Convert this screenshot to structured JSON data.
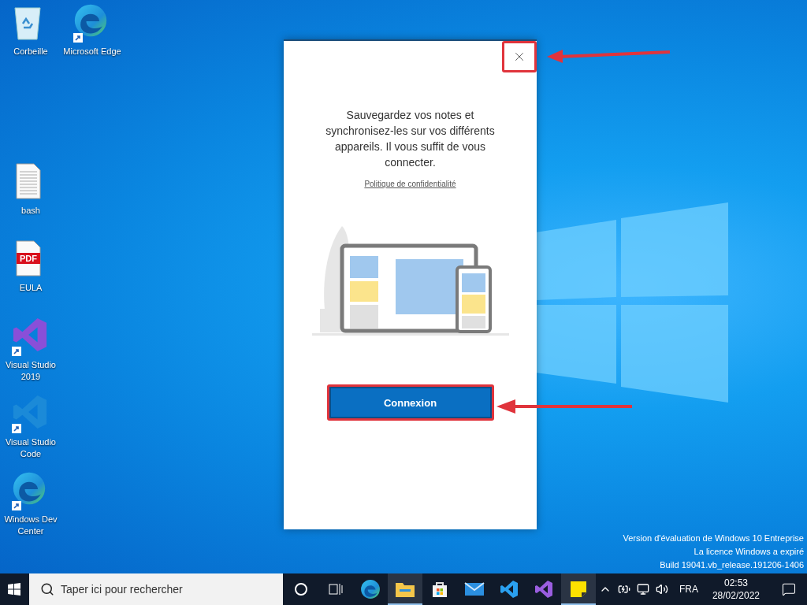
{
  "desktop_icons": [
    {
      "label": "Corbeille",
      "kind": "recycle"
    },
    {
      "label": "Microsoft Edge",
      "kind": "edge"
    },
    {
      "label": "bash",
      "kind": "doc"
    },
    {
      "label": "EULA",
      "kind": "pdf",
      "badge": "PDF"
    },
    {
      "label": "Visual Studio 2019",
      "kind": "vs"
    },
    {
      "label": "Visual Studio Code",
      "kind": "vscode"
    },
    {
      "label": "Windows Dev Center",
      "kind": "edge"
    }
  ],
  "dialog": {
    "message": "Sauvegardez vos notes et synchronisez-les sur vos différents appareils. Il vous suffit de vous connecter.",
    "link": "Politique de confidentialité",
    "button": "Connexion"
  },
  "watermark": [
    "Version d'évaluation de Windows 10 Entreprise",
    "La licence Windows a expiré",
    "Build 19041.vb_release.191206-1406"
  ],
  "taskbar": {
    "search_placeholder": "Taper ici pour rechercher",
    "apps": [
      {
        "kind": "cortana",
        "running": false
      },
      {
        "kind": "taskview",
        "running": false
      },
      {
        "kind": "edge",
        "running": false
      },
      {
        "kind": "explorer",
        "running": true
      },
      {
        "kind": "store",
        "running": false
      },
      {
        "kind": "mail",
        "running": false
      },
      {
        "kind": "vscode",
        "running": false
      },
      {
        "kind": "vs",
        "running": false
      },
      {
        "kind": "sticky",
        "running": true
      }
    ],
    "language": "FRA",
    "time": "02:53",
    "date": "28/02/2022"
  }
}
